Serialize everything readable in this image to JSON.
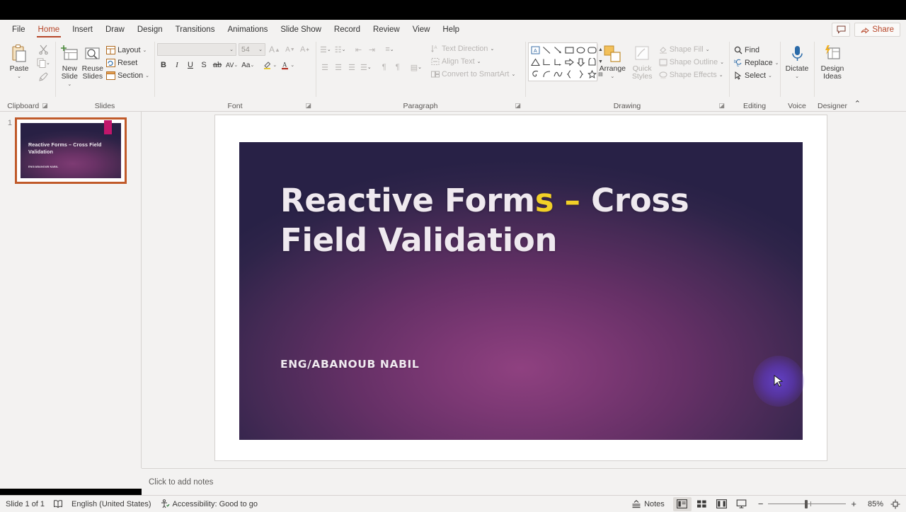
{
  "window": {
    "tabs": [
      {
        "label": "File",
        "active": false
      },
      {
        "label": "Home",
        "active": true
      },
      {
        "label": "Insert",
        "active": false
      },
      {
        "label": "Draw",
        "active": false
      },
      {
        "label": "Design",
        "active": false
      },
      {
        "label": "Transitions",
        "active": false
      },
      {
        "label": "Animations",
        "active": false
      },
      {
        "label": "Slide Show",
        "active": false
      },
      {
        "label": "Record",
        "active": false
      },
      {
        "label": "Review",
        "active": false
      },
      {
        "label": "View",
        "active": false
      },
      {
        "label": "Help",
        "active": false
      }
    ],
    "comment_icon": "comment-icon",
    "share_label": "Share",
    "share_icon": "share-icon"
  },
  "ribbon": {
    "clipboard": {
      "group_label": "Clipboard",
      "paste_label": "Paste",
      "paste_icon": "clipboard-icon",
      "cut_icon": "scissors-icon",
      "copy_icon": "copy-icon",
      "format_painter_icon": "paintbrush-icon",
      "dialog_launcher": "dialog-launcher-icon"
    },
    "slides": {
      "group_label": "Slides",
      "new_slide_label": "New Slide",
      "new_slide_icon": "new-slide-icon",
      "reuse_slides_label": "Reuse Slides",
      "reuse_slides_icon": "reuse-slides-icon",
      "layout_label": "Layout",
      "layout_icon": "layout-icon",
      "reset_label": "Reset",
      "reset_icon": "reset-icon",
      "section_label": "Section",
      "section_icon": "section-icon"
    },
    "font": {
      "group_label": "Font",
      "font_name_value": "",
      "font_name_placeholder": "",
      "font_size_value": "54",
      "grow_font_icon": "grow-font-icon",
      "shrink_font_icon": "shrink-font-icon",
      "clear_formatting_icon": "clear-formatting-icon",
      "bold_label": "B",
      "italic_label": "I",
      "underline_label": "U",
      "shadow_label": "S",
      "strikethrough_icon": "strikethrough-icon",
      "character_spacing_label": "AV",
      "change_case_label": "Aa",
      "text_highlight_icon": "text-highlight-icon",
      "font_color_icon": "font-color-icon",
      "dialog_launcher": "dialog-launcher-icon"
    },
    "paragraph": {
      "group_label": "Paragraph",
      "bullets_icon": "bullets-icon",
      "numbering_icon": "numbering-icon",
      "decrease_indent_icon": "decrease-indent-icon",
      "increase_indent_icon": "increase-indent-icon",
      "line_spacing_icon": "line-spacing-icon",
      "align_left_icon": "align-left-icon",
      "align_center_icon": "align-center-icon",
      "align_right_icon": "align-right-icon",
      "justify_icon": "justify-icon",
      "rtl_icon": "text-direction-rtl-icon",
      "ltr_icon": "text-direction-ltr-icon",
      "columns_icon": "columns-icon",
      "text_direction_label": "Text Direction",
      "text_direction_icon": "text-direction-icon",
      "align_text_label": "Align Text",
      "align_text_icon": "align-text-icon",
      "convert_smartart_label": "Convert to SmartArt",
      "convert_smartart_icon": "smartart-icon",
      "dialog_launcher": "dialog-launcher-icon"
    },
    "drawing": {
      "group_label": "Drawing",
      "shapes_gallery_icon": "shapes-gallery-icon",
      "gallery_up_icon": "gallery-scroll-up-icon",
      "gallery_down_icon": "gallery-scroll-down-icon",
      "gallery_more_icon": "gallery-more-icon",
      "arrange_label": "Arrange",
      "arrange_icon": "arrange-icon",
      "quick_styles_label": "Quick Styles",
      "quick_styles_icon": "quick-styles-icon",
      "shape_fill_label": "Shape Fill",
      "shape_fill_icon": "shape-fill-icon",
      "shape_outline_label": "Shape Outline",
      "shape_outline_icon": "shape-outline-icon",
      "shape_effects_label": "Shape Effects",
      "shape_effects_icon": "shape-effects-icon",
      "dialog_launcher": "dialog-launcher-icon"
    },
    "editing": {
      "group_label": "Editing",
      "find_label": "Find",
      "find_icon": "search-icon",
      "replace_label": "Replace",
      "replace_icon": "replace-icon",
      "select_label": "Select",
      "select_icon": "select-pointer-icon"
    },
    "voice": {
      "group_label": "Voice",
      "dictate_label": "Dictate",
      "dictate_icon": "microphone-icon"
    },
    "designer": {
      "group_label": "Designer",
      "design_ideas_label": "Design Ideas",
      "design_ideas_icon": "design-ideas-icon",
      "collapse_ribbon_icon": "chevron-up-icon"
    }
  },
  "thumbnails": [
    {
      "number": "1",
      "title": "Reactive Forms – Cross Field Validation",
      "subtitle": "ENG/ABANOUB NABIL",
      "selected": true
    }
  ],
  "slide": {
    "title_line1_before": "Reactive Form",
    "title_line1_highlight": "s –",
    "title_line1_after": " Cross",
    "title_line2": "Field Validation",
    "subtitle": "ENG/ABANOUB NABIL",
    "accent_color": "#c2166b",
    "title_color": "#efe9ef",
    "highlight_color": "#f2d027",
    "cursor_icon": "mouse-pointer-icon",
    "click_highlight_color": "#6946e6"
  },
  "notes": {
    "placeholder": "Click to add notes"
  },
  "status": {
    "slide_counter": "Slide 1 of 1",
    "spelling_icon": "spell-check-icon",
    "language": "English (United States)",
    "accessibility_icon": "accessibility-icon",
    "accessibility": "Accessibility: Good to go",
    "notes_label": "Notes",
    "notes_icon": "notes-icon",
    "view_normal_icon": "view-normal-icon",
    "view_sorter_icon": "view-slide-sorter-icon",
    "view_reading_icon": "view-reading-icon",
    "view_slideshow_icon": "view-slideshow-icon",
    "zoom_out_label": "−",
    "zoom_in_label": "+",
    "zoom_level": "85%",
    "fit_slide_icon": "fit-to-window-icon"
  }
}
